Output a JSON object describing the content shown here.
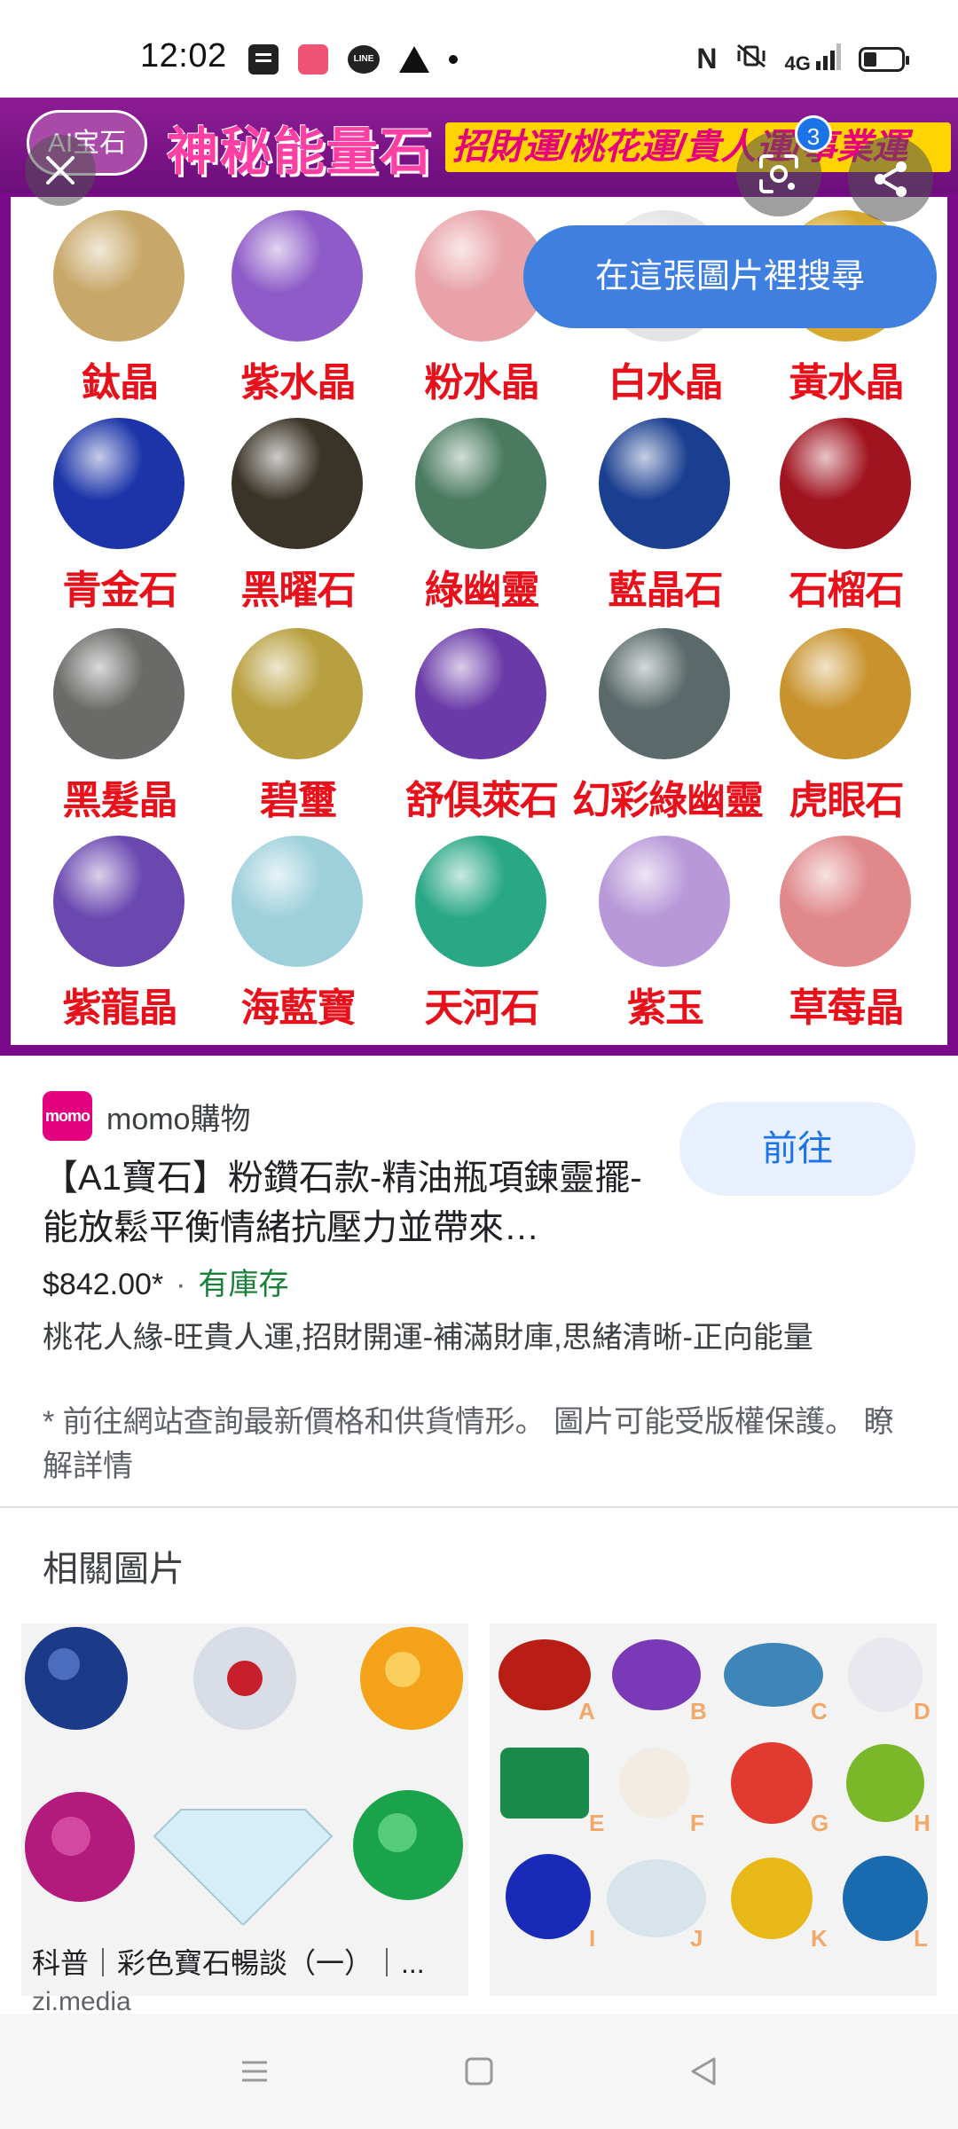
{
  "status_bar": {
    "time": "12:02",
    "line_icon_label": "LINE",
    "signal_label": "4G",
    "icons": [
      "message-icon",
      "app-pink-icon",
      "line-icon",
      "warning-icon",
      "dot-icon",
      "nfc-icon",
      "vibrate-icon",
      "signal-icon",
      "battery-icon"
    ]
  },
  "hero": {
    "logo_text": "AI宝石",
    "banner_title": "神秘能量石",
    "banner_subtitle": "招財運/桃花運/貴人運/事業運",
    "lens_badge": "3",
    "search_chip": "在這張圖片裡搜尋",
    "stones": [
      {
        "name": "鈦晶",
        "color": "#c8a86a"
      },
      {
        "name": "紫水晶",
        "color": "#8e5bc8"
      },
      {
        "name": "粉水晶",
        "color": "#e8a2a8"
      },
      {
        "name": "白水晶",
        "color": "#e4e4e4"
      },
      {
        "name": "黃水晶",
        "color": "#d6a830"
      },
      {
        "name": "青金石",
        "color": "#1c34a8"
      },
      {
        "name": "黑曜石",
        "color": "#3a3428"
      },
      {
        "name": "綠幽靈",
        "color": "#4a7a60"
      },
      {
        "name": "藍晶石",
        "color": "#1a3e90"
      },
      {
        "name": "石榴石",
        "color": "#a01420"
      },
      {
        "name": "黑髮晶",
        "color": "#6a6a68"
      },
      {
        "name": "碧璽",
        "color": "#b8a040"
      },
      {
        "name": "舒俱萊石",
        "color": "#6a3aa8"
      },
      {
        "name": "幻彩綠幽靈",
        "color": "#5a6a6a"
      },
      {
        "name": "虎眼石",
        "color": "#c8922c"
      },
      {
        "name": "紫龍晶",
        "color": "#6a48b0"
      },
      {
        "name": "海藍寶",
        "color": "#9ed0dc"
      },
      {
        "name": "天河石",
        "color": "#2aa886"
      },
      {
        "name": "紫玉",
        "color": "#b898d8"
      },
      {
        "name": "草莓晶",
        "color": "#e0888a"
      }
    ]
  },
  "product": {
    "merchant_logo": "momo",
    "merchant_name": "momo購物",
    "go_button": "前往",
    "title": "【A1寶石】粉鑽石款-精油瓶項鍊靈擺-能放鬆平衡情緒抗壓力並帶來…",
    "price": "$842.00*",
    "separator": "·",
    "stock": "有庫存",
    "description": "桃花人緣-旺貴人運,招財開運-補滿財庫,思緒清晰-正向能量",
    "disclaimer": "* 前往網站查詢最新價格和供貨情形。 圖片可能受版權保護。",
    "learn_more": "瞭解詳情"
  },
  "related": {
    "title": "相關圖片",
    "cards": [
      {
        "caption": "科普｜彩色寶石暢談（一）｜...",
        "source": "zi.media"
      },
      {
        "caption": "",
        "source": ""
      }
    ],
    "gem_letters": [
      "A",
      "B",
      "C",
      "D",
      "E",
      "F",
      "G",
      "H",
      "I",
      "J",
      "K",
      "L"
    ]
  },
  "colors": {
    "banner_purple": "#7a0a8a",
    "chip_blue": "#3f7fe0",
    "stone_label_red": "#e8101a",
    "stock_green": "#188038",
    "go_button_bg": "#e8f0fe"
  }
}
